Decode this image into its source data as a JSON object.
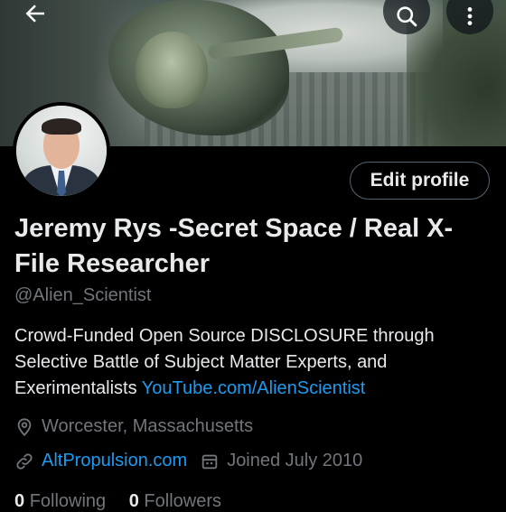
{
  "header": {
    "back_icon": "arrow-left-icon",
    "search_icon": "search-icon",
    "more_icon": "more-vertical-icon"
  },
  "profile": {
    "edit_label": "Edit profile",
    "name": "Jeremy Rys -Secret Space / Real X-File Researcher",
    "handle": "@Alien_Scientist",
    "bio_text": "Crowd-Funded Open Source DISCLOSURE through Selective Battle of Subject Matter Experts, and Exerimentalists ",
    "bio_link": "YouTube.com/AlienScientist",
    "location": "Worcester, Massachusetts",
    "website": "AltPropulsion.com",
    "joined": "Joined July 2010",
    "following_count": "0",
    "following_label": "Following",
    "followers_count": "0",
    "followers_label": "Followers"
  },
  "colors": {
    "background": "#000000",
    "text": "#e7e9ea",
    "muted": "#71767b",
    "link": "#1d9bf0"
  }
}
